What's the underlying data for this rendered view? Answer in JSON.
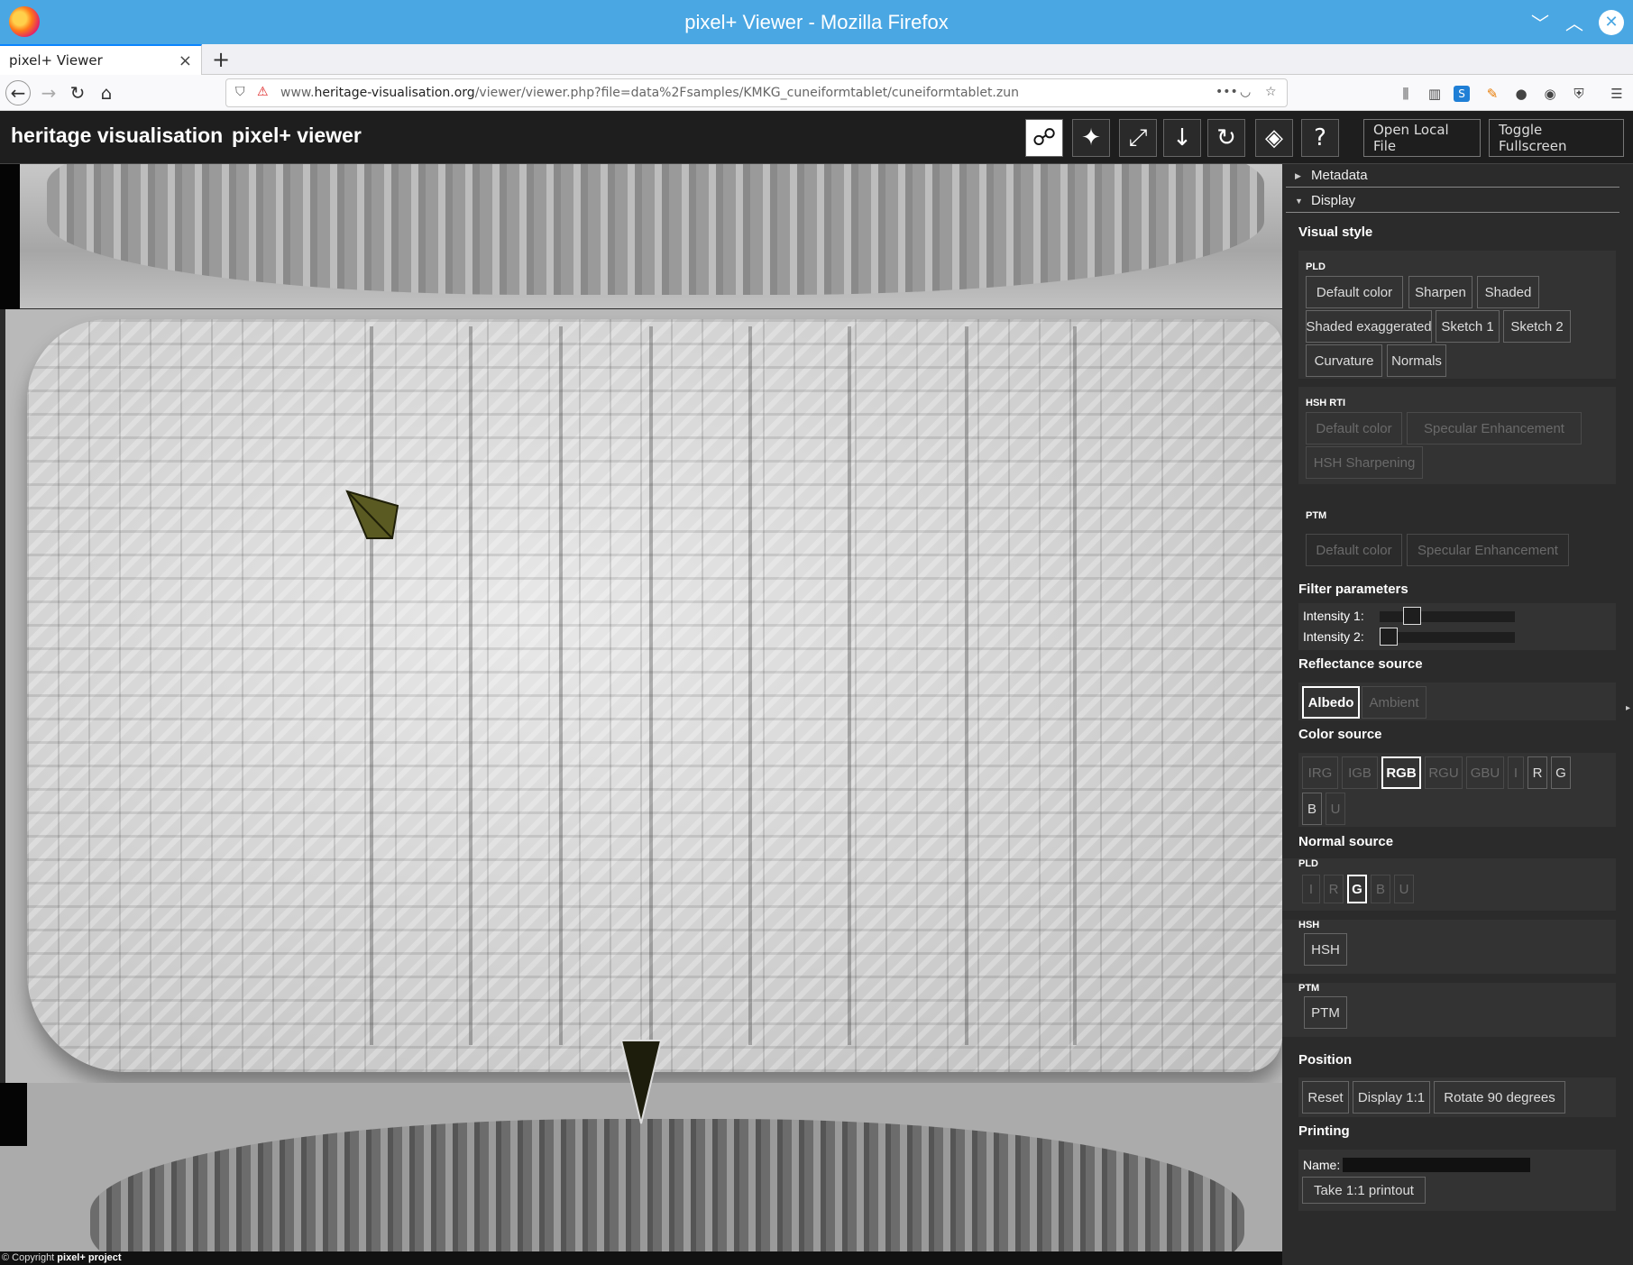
{
  "window": {
    "title": "pixel+ Viewer - Mozilla Firefox",
    "controls": [
      "chevron-down-icon",
      "chevron-up-icon",
      "close-icon"
    ]
  },
  "tab": {
    "label": "pixel+ Viewer",
    "close": "×",
    "new": "+"
  },
  "url": {
    "prefix": "www.",
    "host": "heritage-visualisation.org",
    "path": "/viewer/viewer.php?file=data%2Fsamples/KMKG_cuneiformtablet/cuneiformtablet.zun",
    "more": "•••"
  },
  "header": {
    "brand": "heritage visualisation",
    "app": "pixel+ viewer",
    "tools": [
      {
        "name": "light-direction-icon",
        "glyph": "☍",
        "active": true
      },
      {
        "name": "magic-wand-icon",
        "glyph": "✦",
        "active": false
      },
      {
        "name": "fit-expand-icon",
        "glyph": "⤢",
        "active": false
      },
      {
        "name": "download-icon",
        "glyph": "↓",
        "active": false
      },
      {
        "name": "rotate-icon",
        "glyph": "↻",
        "active": false
      },
      {
        "name": "3d-box-icon",
        "glyph": "◈",
        "active": false
      },
      {
        "name": "help-icon",
        "glyph": "?",
        "active": false
      }
    ],
    "open_local": "Open Local File",
    "toggle_fullscreen": "Toggle Fullscreen"
  },
  "footer": {
    "prefix": "© Copyright ",
    "project": "pixel+ project"
  },
  "panel": {
    "metadata": "Metadata",
    "display": "Display",
    "visual_style": "Visual style",
    "pld_label": "PLD",
    "pld_buttons": [
      "Default color",
      "Sharpen",
      "Shaded",
      "Shaded exaggerated",
      "Sketch 1",
      "Sketch 2",
      "Curvature",
      "Normals"
    ],
    "hsh_rti_label": "HSH RTI",
    "hsh_rti_buttons": [
      "Default color",
      "Specular Enhancement",
      "HSH Sharpening"
    ],
    "ptm_label": "PTM",
    "ptm_buttons": [
      "Default color",
      "Specular Enhancement"
    ],
    "filter_params": "Filter parameters",
    "intensity1": "Intensity 1:",
    "intensity2": "Intensity 2:",
    "intensity1_value": 0.2,
    "intensity2_value": 0.0,
    "reflectance_source": "Reflectance source",
    "reflectance_buttons": [
      "Albedo",
      "Ambient"
    ],
    "reflectance_selected": "Albedo",
    "color_source": "Color source",
    "color_buttons": [
      "IRG",
      "IGB",
      "RGB",
      "RGU",
      "GBU",
      "I",
      "R",
      "G",
      "B",
      "U"
    ],
    "color_selected": "RGB",
    "normal_source": "Normal source",
    "normal_pld_label": "PLD",
    "normal_pld_buttons": [
      "I",
      "R",
      "G",
      "B",
      "U"
    ],
    "normal_pld_selected": "G",
    "normal_hsh_label": "HSH",
    "normal_hsh_button": "HSH",
    "normal_ptm_label": "PTM",
    "normal_ptm_button": "PTM",
    "position": "Position",
    "position_buttons": [
      "Reset",
      "Display 1:1",
      "Rotate 90 degrees"
    ],
    "printing": "Printing",
    "name_label": "Name:",
    "printout": "Take 1:1 printout"
  }
}
